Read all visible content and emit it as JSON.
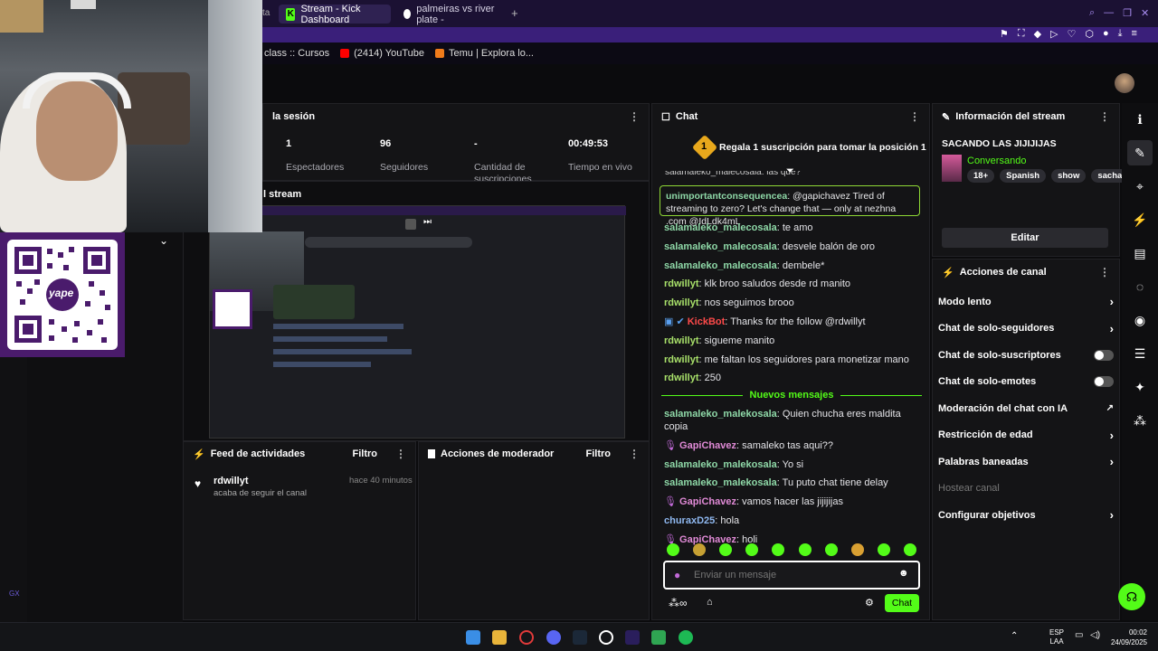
{
  "browser": {
    "tabs": [
      {
        "label": "Stream - Kick Dashboard",
        "active": true
      },
      {
        "label": "palmeiras vs river plate -",
        "active": false
      }
    ],
    "new_tab": "+",
    "bookmarks": [
      {
        "label": "class :: Cursos",
        "color": "#444"
      },
      {
        "label": "(2414) YouTube",
        "color": "#ff0000"
      },
      {
        "label": "Temu | Explora lo...",
        "color": "#f07b1a"
      }
    ]
  },
  "stats": {
    "title": "la sesión",
    "items": [
      {
        "value": "1",
        "label": "Espectadores"
      },
      {
        "value": "96",
        "label": "Seguidores"
      },
      {
        "value": "-",
        "label": "Cantidad de suscripciones"
      },
      {
        "value": "00:49:53",
        "label": "Tiempo en vivo"
      }
    ]
  },
  "preview": {
    "title": "l stream"
  },
  "activity": {
    "title": "Feed de actividades",
    "filter": "Filtro",
    "entry": {
      "user": "rdwillyt",
      "text": "acaba de seguir el canal",
      "time": "hace 40 minutos"
    }
  },
  "moderator": {
    "title": "Acciones de moderador",
    "filter": "Filtro"
  },
  "chat": {
    "title": "Chat",
    "banner": "Regala 1 suscripción para tomar la posición 1",
    "banner_num": "1",
    "cut_line": "salamaleko_malecosala: las que?",
    "pinned_user": "unimportantconsequencea",
    "pinned_text": ": @gapichavez Tired of streaming to zero? Let's change that — only at nezhna .com @IdLdk4mL",
    "messages_before": [
      {
        "user": "salamaleko_malecosala",
        "text": ": te amo",
        "cls": "u-green"
      },
      {
        "user": "salamaleko_malecosala",
        "text": ": desvele balón de oro",
        "cls": "u-green"
      },
      {
        "user": "salamaleko_malecosala",
        "text": ": dembele*",
        "cls": "u-green"
      },
      {
        "user": "rdwillyt",
        "text": ": klk broo saludos desde rd manito",
        "cls": "u-lime"
      },
      {
        "user": "rdwillyt",
        "text": ": nos seguimos brooo",
        "cls": "u-lime"
      },
      {
        "user": "KickBot",
        "text": ": Thanks for the follow @rdwillyt",
        "cls": "u-red"
      },
      {
        "user": "rdwillyt",
        "text": ": sigueme manito",
        "cls": "u-lime"
      },
      {
        "user": "rdwillyt",
        "text": ": me faltan los seguidores para monetizar mano",
        "cls": "u-lime"
      },
      {
        "user": "rdwillyt",
        "text": ": 250",
        "cls": "u-lime"
      }
    ],
    "divider": "Nuevos mensajes",
    "messages_after": [
      {
        "user": "salamaleko_malekosala",
        "text": ": Quien chucha eres maldita copia",
        "cls": "u-green"
      },
      {
        "user": "GapiChavez",
        "text": ": samaleko tas aqui??",
        "cls": "u-pink"
      },
      {
        "user": "salamaleko_malekosala",
        "text": ": Yo si",
        "cls": "u-green"
      },
      {
        "user": "salamaleko_malekosala",
        "text": ": Tu puto chat tiene delay",
        "cls": "u-green"
      },
      {
        "user": "GapiChavez",
        "text": ": vamos hacer las jijijijas",
        "cls": "u-pink"
      },
      {
        "user": "churaxD25",
        "text": ": hola",
        "cls": "u-blue"
      },
      {
        "user": "GapiChavez",
        "text": ": holi",
        "cls": "u-pink"
      }
    ],
    "input_placeholder": "Enviar un mensaje",
    "send_label": "Chat"
  },
  "stream_info": {
    "title": "Información del stream",
    "stream_title": "SACANDO LAS JIJIJIJAS",
    "category": "Conversando",
    "tags": [
      "18+",
      "Spanish",
      "show",
      "sacha"
    ],
    "edit_label": "Editar"
  },
  "channel_actions": {
    "title": "Acciones de canal",
    "items": [
      {
        "label": "Modo lento",
        "control": "chevron"
      },
      {
        "label": "Chat de solo-seguidores",
        "control": "chevron"
      },
      {
        "label": "Chat de solo-suscriptores",
        "control": "toggle"
      },
      {
        "label": "Chat de solo-emotes",
        "control": "toggle"
      },
      {
        "label": "Moderación del chat con IA",
        "control": "external"
      },
      {
        "label": "Restricción de edad",
        "control": "chevron"
      },
      {
        "label": "Palabras baneadas",
        "control": "chevron"
      },
      {
        "label": "Hostear canal",
        "control": "disabled"
      },
      {
        "label": "Configurar objetivos",
        "control": "chevron"
      }
    ]
  },
  "taskbar": {
    "lang": "ESP",
    "lang2": "LAA",
    "time": "00:02",
    "date": "24/09/2025",
    "gx": "GX"
  },
  "qr": {
    "brand": "yape"
  },
  "colors": {
    "accent": "#53fc18",
    "browser": "#1b1133"
  }
}
